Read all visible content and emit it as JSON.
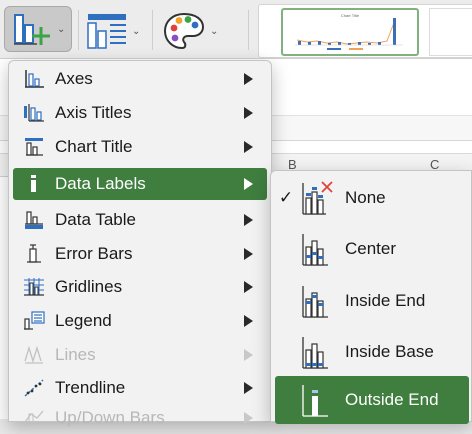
{
  "ribbon": {
    "add_element_icon": "add-chart-element-icon",
    "quick_layout_icon": "quick-layout-icon",
    "change_colors_icon": "palette-icon",
    "gallery_thumb_title": "Chart Title"
  },
  "sheet": {
    "columns": [
      "B",
      "C"
    ]
  },
  "menu": {
    "items": [
      {
        "label": "Axes",
        "icon": "axes-icon"
      },
      {
        "label": "Axis Titles",
        "icon": "axis-titles-icon"
      },
      {
        "label": "Chart Title",
        "icon": "chart-title-icon"
      },
      {
        "label": "Data Labels",
        "icon": "data-labels-icon",
        "state": "active"
      },
      {
        "label": "Data Table",
        "icon": "data-table-icon"
      },
      {
        "label": "Error Bars",
        "icon": "error-bars-icon"
      },
      {
        "label": "Gridlines",
        "icon": "gridlines-icon"
      },
      {
        "label": "Legend",
        "icon": "legend-icon"
      },
      {
        "label": "Lines",
        "icon": "lines-icon",
        "state": "disabled"
      },
      {
        "label": "Trendline",
        "icon": "trendline-icon"
      },
      {
        "label": "Up/Down Bars",
        "icon": "up-down-bars-icon",
        "state": "disabled"
      }
    ]
  },
  "submenu": {
    "items": [
      {
        "label": "None",
        "icon": "no-data-labels-icon",
        "checked": "✓"
      },
      {
        "label": "Center",
        "icon": "center-labels-icon",
        "checked": ""
      },
      {
        "label": "Inside End",
        "icon": "inside-end-labels-icon",
        "checked": ""
      },
      {
        "label": "Inside Base",
        "icon": "inside-base-labels-icon",
        "checked": ""
      },
      {
        "label": "Outside End",
        "icon": "outside-end-labels-icon",
        "checked": "",
        "state": "active"
      }
    ]
  },
  "colors": {
    "accent_green": "#3f7e3f",
    "icon_blue": "#2f6fc0",
    "plus_green": "#3aa447",
    "x_red": "#e0413a"
  }
}
